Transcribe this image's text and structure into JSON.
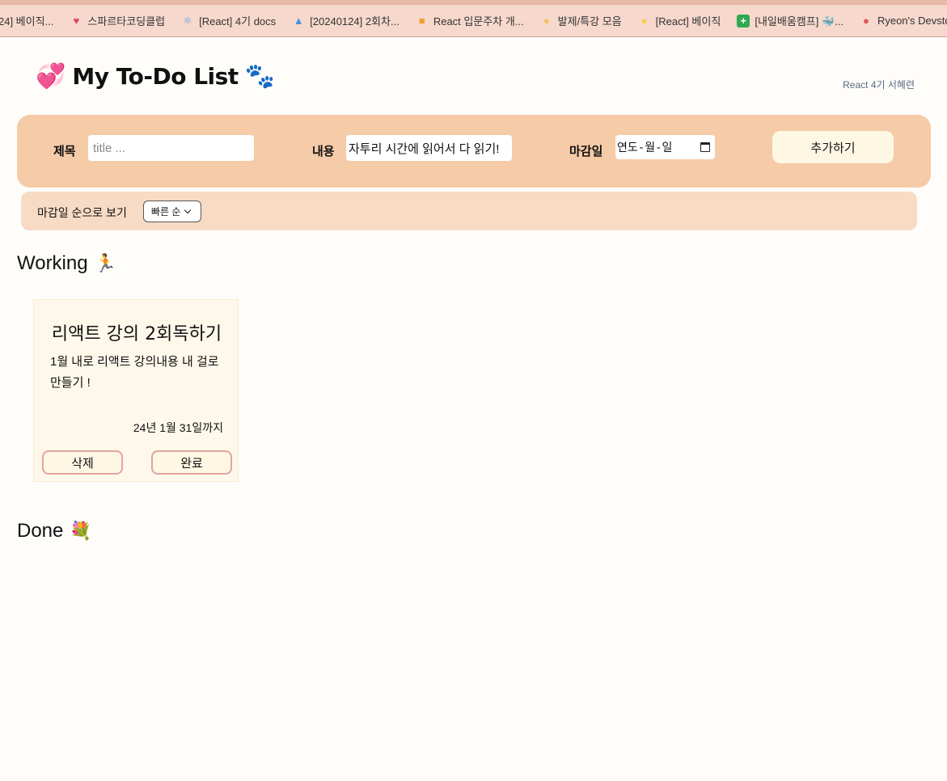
{
  "bookmarks": [
    {
      "label": "24] 베이직...",
      "icon": "",
      "color": "#ffffff"
    },
    {
      "label": "스파르타코딩클럽",
      "icon": "heart-icon",
      "color": "#e0455a"
    },
    {
      "label": "[React] 4기 docs",
      "icon": "react-icon",
      "color": "#61a8d8"
    },
    {
      "label": "[20240124] 2회차...",
      "icon": "dress-icon",
      "color": "#4a90d9"
    },
    {
      "label": "React 입문주차 개...",
      "icon": "book-icon",
      "color": "#f0a030"
    },
    {
      "label": "발제/특강 모음",
      "icon": "person-icon",
      "color": "#f3c060"
    },
    {
      "label": "[React] 베이직",
      "icon": "chick-icon",
      "color": "#f5d040"
    },
    {
      "label": "[내일배움캠프] 🐳...",
      "icon": "sheet-icon",
      "color": "#2fa84f"
    },
    {
      "label": "Ryeon's Devstory",
      "icon": "blog-icon",
      "color": "#e05050"
    }
  ],
  "header": {
    "heart_emoji": "💞",
    "title": "My To-Do List",
    "paws_emoji": "🐾",
    "author": "React 4기 서혜련"
  },
  "form": {
    "title_label": "제목",
    "title_placeholder": "title ...",
    "content_label": "내용",
    "content_value": "자투리 시간에 읽어서 다 읽기!",
    "deadline_label": "마감일",
    "deadline_placeholder": "연도-월-일",
    "add_button": "추가하기"
  },
  "sort": {
    "label": "마감일 순으로 보기",
    "selected": "빠른 순"
  },
  "working": {
    "title": "Working",
    "emoji": "🏃",
    "cards": [
      {
        "title": "리액트 강의 2회독하기",
        "body": "1월 내로 리액트 강의내용 내 걸로 만들기 !",
        "deadline": "24년 1월 31일까지",
        "delete_label": "삭제",
        "complete_label": "완료"
      }
    ]
  },
  "done": {
    "title": "Done",
    "emoji": "💐"
  }
}
